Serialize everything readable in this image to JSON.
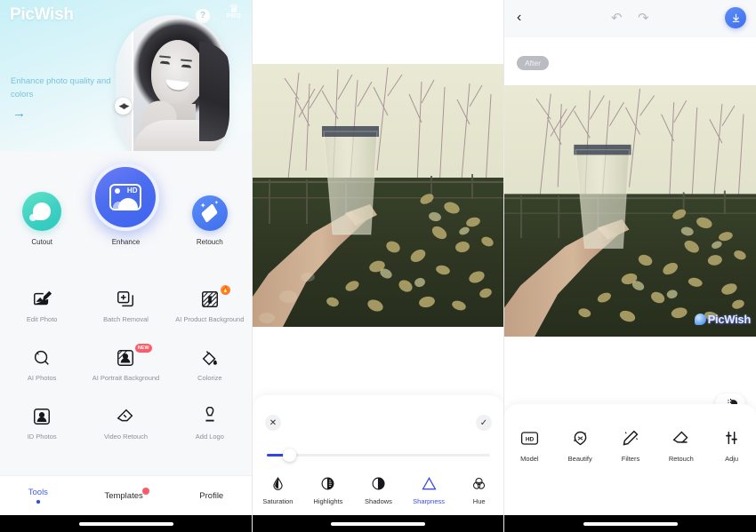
{
  "app": {
    "name": "PicWish"
  },
  "screen1": {
    "logo": "PicWish",
    "help_icon": "?",
    "pro": {
      "crown_icon": "♛",
      "label": "PRO"
    },
    "tagline": "Enhance photo quality and colors",
    "arrow_icon": "→",
    "before_after_handle_icon": "◀▶",
    "main_features": [
      {
        "label": "Cutout",
        "icon": "cutout-icon"
      },
      {
        "label": "Enhance",
        "icon": "enhance-hd-icon"
      },
      {
        "label": "Retouch",
        "icon": "retouch-eraser-icon"
      }
    ],
    "tools": [
      {
        "label": "Edit Photo",
        "icon": "edit-photo-icon",
        "badge": ""
      },
      {
        "label": "Batch Removal",
        "icon": "batch-removal-icon",
        "badge": ""
      },
      {
        "label": "AI Product Background",
        "icon": "ai-product-background-icon",
        "badge": "hot"
      },
      {
        "label": "AI Photos",
        "icon": "ai-photos-icon",
        "badge": ""
      },
      {
        "label": "AI Portrait Background",
        "icon": "ai-portrait-background-icon",
        "badge": "NEW"
      },
      {
        "label": "Colorize",
        "icon": "colorize-icon",
        "badge": ""
      },
      {
        "label": "ID Photos",
        "icon": "id-photos-icon",
        "badge": ""
      },
      {
        "label": "Video Retouch",
        "icon": "video-retouch-icon",
        "badge": ""
      },
      {
        "label": "Add Logo",
        "icon": "add-logo-icon",
        "badge": ""
      }
    ],
    "tabbar": [
      {
        "label": "Tools",
        "active": true
      },
      {
        "label": "Templates",
        "active": false,
        "badge": true
      },
      {
        "label": "Profile",
        "active": false
      }
    ]
  },
  "screen2": {
    "close_icon": "✕",
    "apply_icon": "✓",
    "slider": {
      "value": 8,
      "min": 0,
      "max": 100
    },
    "adjustments": [
      {
        "label": "Saturation",
        "icon": "droplet-icon",
        "selected": false
      },
      {
        "label": "Highlights",
        "icon": "half-circle-icon",
        "selected": false
      },
      {
        "label": "Shadows",
        "icon": "contrast-circle-icon",
        "selected": false
      },
      {
        "label": "Sharpness",
        "icon": "triangle-icon",
        "selected": true
      },
      {
        "label": "Hue",
        "icon": "three-circles-icon",
        "selected": false
      }
    ]
  },
  "screen3": {
    "back_icon": "‹",
    "undo_icon": "↶",
    "redo_icon": "↷",
    "download_icon": "download-icon",
    "after_badge": "After",
    "watermark": "PicWish",
    "compare_icon": "compare-split-icon",
    "tools": [
      {
        "label": "Model",
        "icon": "hd-model-icon"
      },
      {
        "label": "Beautify",
        "icon": "beautify-icon"
      },
      {
        "label": "Filters",
        "icon": "filters-pen-icon"
      },
      {
        "label": "Retouch",
        "icon": "retouch-eraser-icon"
      },
      {
        "label": "Adju",
        "icon": "adjust-sliders-icon"
      }
    ]
  },
  "colors": {
    "accent_blue": "#3f63ee",
    "cutout_teal": "#3fd0c4",
    "badge_red": "#ff5a68",
    "badge_orange": "#ff6a2a",
    "hero_cyan": "#c7f0f7"
  }
}
